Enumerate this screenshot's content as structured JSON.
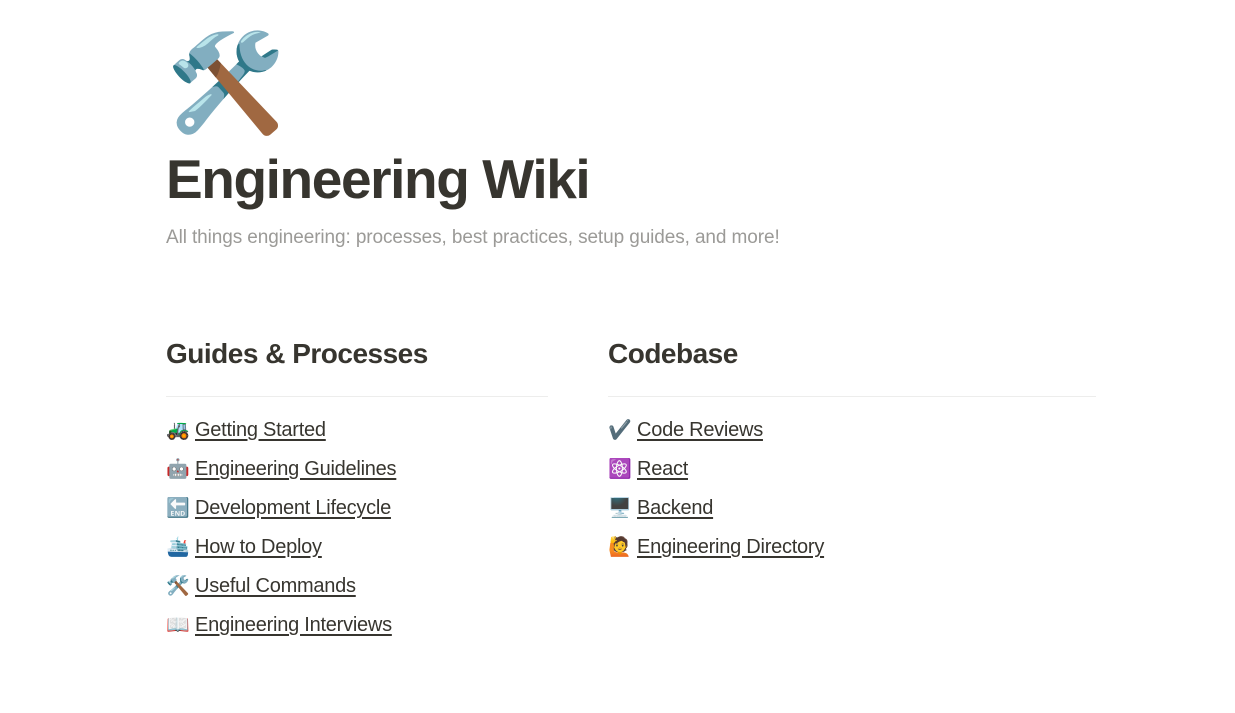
{
  "page": {
    "emoji": "🛠️",
    "emoji_name": "hammer-and-wrench",
    "title": "Engineering Wiki",
    "subtitle": "All things engineering: processes, best practices, setup guides, and more!"
  },
  "colors": {
    "background": "#ffffff",
    "title_text": "#37352f",
    "subtitle_text": "#9b9a97",
    "link_text": "#37352f",
    "divider": "#ededec",
    "check_accent": "#5a519b",
    "react_accent": "#9b6fd4"
  },
  "columns": [
    {
      "heading": "Guides & Processes",
      "items": [
        {
          "icon": "🚜",
          "icon_name": "tractor-icon",
          "label": "Getting Started"
        },
        {
          "icon": "🤖",
          "icon_name": "robot-icon",
          "label": "Engineering Guidelines"
        },
        {
          "icon": "🔚",
          "icon_name": "end-arrow-icon",
          "label": "Development Lifecycle"
        },
        {
          "icon": "🛳️",
          "icon_name": "passenger-ship-icon",
          "label": "How to Deploy"
        },
        {
          "icon": "🛠️",
          "icon_name": "hammer-and-wrench-icon",
          "label": "Useful Commands"
        },
        {
          "icon": "📖",
          "icon_name": "open-book-icon",
          "label": "Engineering Interviews"
        }
      ]
    },
    {
      "heading": "Codebase",
      "items": [
        {
          "icon": "✔️",
          "icon_name": "check-mark-icon",
          "label": "Code Reviews"
        },
        {
          "icon": "⚛️",
          "icon_name": "atom-symbol-icon",
          "label": "React"
        },
        {
          "icon": "🖥️",
          "icon_name": "desktop-computer-icon",
          "label": "Backend"
        },
        {
          "icon": "🙋",
          "icon_name": "person-raising-hand-icon",
          "label": "Engineering Directory"
        }
      ]
    }
  ]
}
